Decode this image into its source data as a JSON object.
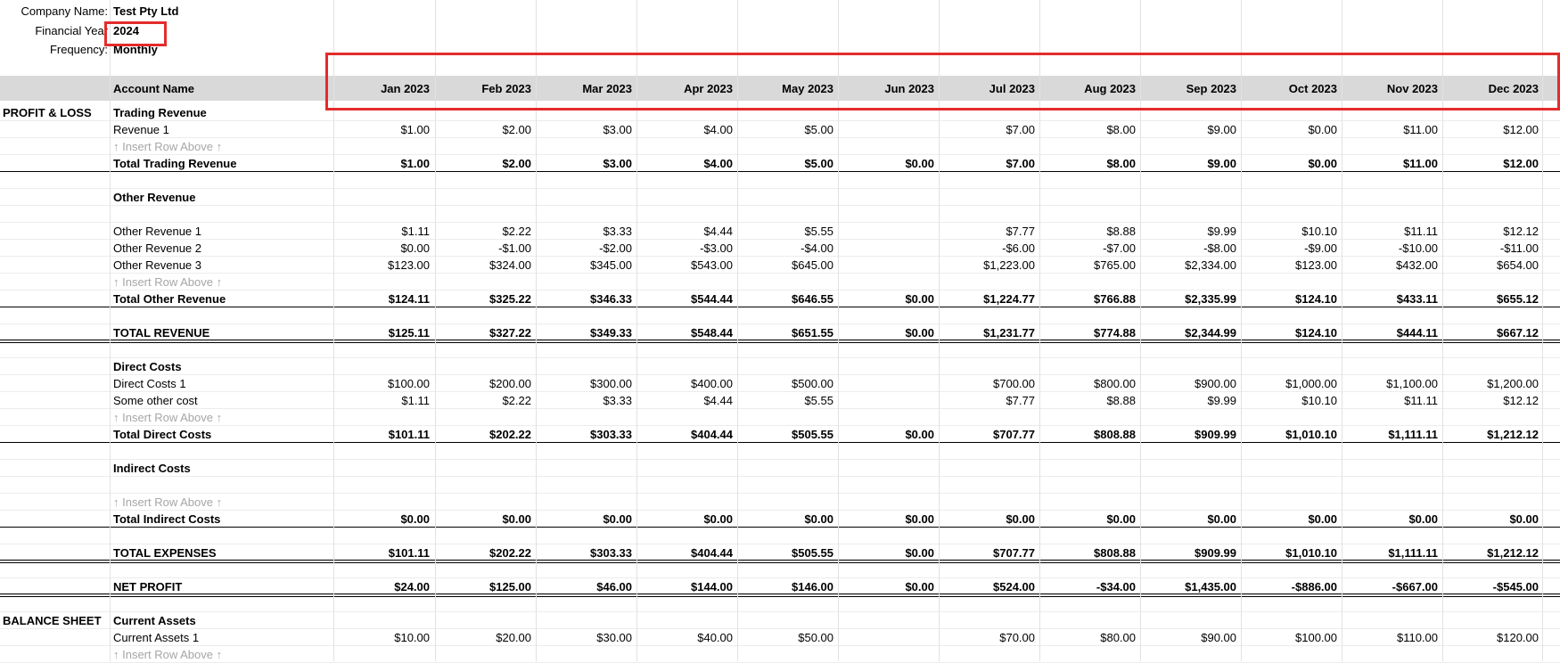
{
  "header": {
    "company_label": "Company Name:",
    "company_value": "Test Pty Ltd",
    "year_label": "Financial Year",
    "year_value": "2024",
    "frequency_label": "Frequency:",
    "frequency_value": "Monthly"
  },
  "table": {
    "account_name_header": "Account Name",
    "months": [
      "Jan 2023",
      "Feb 2023",
      "Mar 2023",
      "Apr 2023",
      "May 2023",
      "Jun 2023",
      "Jul 2023",
      "Aug 2023",
      "Sep 2023",
      "Oct 2023",
      "Nov 2023",
      "Dec 2023"
    ]
  },
  "rows": [
    {
      "type": "section",
      "section": "PROFIT & LOSS",
      "label": "Trading Revenue"
    },
    {
      "type": "data",
      "label": "Revenue 1",
      "values": [
        "$1.00",
        "$2.00",
        "$3.00",
        "$4.00",
        "$5.00",
        "",
        "$7.00",
        "$8.00",
        "$9.00",
        "$0.00",
        "$11.00",
        "$12.00"
      ]
    },
    {
      "type": "insert",
      "label": "↑ Insert Row Above ↑"
    },
    {
      "type": "total",
      "label": "Total Trading Revenue",
      "values": [
        "$1.00",
        "$2.00",
        "$3.00",
        "$4.00",
        "$5.00",
        "$0.00",
        "$7.00",
        "$8.00",
        "$9.00",
        "$0.00",
        "$11.00",
        "$12.00"
      ],
      "rule": "single"
    },
    {
      "type": "blank"
    },
    {
      "type": "heading",
      "label": "Other Revenue"
    },
    {
      "type": "blank"
    },
    {
      "type": "data",
      "label": "Other Revenue 1",
      "values": [
        "$1.11",
        "$2.22",
        "$3.33",
        "$4.44",
        "$5.55",
        "",
        "$7.77",
        "$8.88",
        "$9.99",
        "$10.10",
        "$11.11",
        "$12.12"
      ]
    },
    {
      "type": "data",
      "label": "Other Revenue 2",
      "values": [
        "$0.00",
        "-$1.00",
        "-$2.00",
        "-$3.00",
        "-$4.00",
        "",
        "-$6.00",
        "-$7.00",
        "-$8.00",
        "-$9.00",
        "-$10.00",
        "-$11.00"
      ]
    },
    {
      "type": "data",
      "label": "Other Revenue 3",
      "values": [
        "$123.00",
        "$324.00",
        "$345.00",
        "$543.00",
        "$645.00",
        "",
        "$1,223.00",
        "$765.00",
        "$2,334.00",
        "$123.00",
        "$432.00",
        "$654.00"
      ]
    },
    {
      "type": "insert",
      "label": "↑ Insert Row Above ↑"
    },
    {
      "type": "total",
      "label": "Total Other Revenue",
      "values": [
        "$124.11",
        "$325.22",
        "$346.33",
        "$544.44",
        "$646.55",
        "$0.00",
        "$1,224.77",
        "$766.88",
        "$2,335.99",
        "$124.10",
        "$433.11",
        "$655.12"
      ],
      "rule": "single"
    },
    {
      "type": "blank"
    },
    {
      "type": "total",
      "label": "TOTAL REVENUE",
      "values": [
        "$125.11",
        "$327.22",
        "$349.33",
        "$548.44",
        "$651.55",
        "$0.00",
        "$1,231.77",
        "$774.88",
        "$2,344.99",
        "$124.10",
        "$444.11",
        "$667.12"
      ],
      "rule": "double"
    },
    {
      "type": "blank"
    },
    {
      "type": "heading",
      "label": "Direct Costs"
    },
    {
      "type": "data",
      "label": "Direct Costs 1",
      "values": [
        "$100.00",
        "$200.00",
        "$300.00",
        "$400.00",
        "$500.00",
        "",
        "$700.00",
        "$800.00",
        "$900.00",
        "$1,000.00",
        "$1,100.00",
        "$1,200.00"
      ]
    },
    {
      "type": "data",
      "label": "Some other cost",
      "values": [
        "$1.11",
        "$2.22",
        "$3.33",
        "$4.44",
        "$5.55",
        "",
        "$7.77",
        "$8.88",
        "$9.99",
        "$10.10",
        "$11.11",
        "$12.12"
      ]
    },
    {
      "type": "insert",
      "label": "↑ Insert Row Above ↑"
    },
    {
      "type": "total",
      "label": "Total Direct Costs",
      "values": [
        "$101.11",
        "$202.22",
        "$303.33",
        "$404.44",
        "$505.55",
        "$0.00",
        "$707.77",
        "$808.88",
        "$909.99",
        "$1,010.10",
        "$1,111.11",
        "$1,212.12"
      ],
      "rule": "single"
    },
    {
      "type": "blank"
    },
    {
      "type": "heading",
      "label": "Indirect Costs"
    },
    {
      "type": "blank"
    },
    {
      "type": "insert",
      "label": "↑ Insert Row Above ↑"
    },
    {
      "type": "total",
      "label": "Total Indirect Costs",
      "values": [
        "$0.00",
        "$0.00",
        "$0.00",
        "$0.00",
        "$0.00",
        "$0.00",
        "$0.00",
        "$0.00",
        "$0.00",
        "$0.00",
        "$0.00",
        "$0.00"
      ],
      "rule": "single"
    },
    {
      "type": "blank"
    },
    {
      "type": "total",
      "label": "TOTAL EXPENSES",
      "values": [
        "$101.11",
        "$202.22",
        "$303.33",
        "$404.44",
        "$505.55",
        "$0.00",
        "$707.77",
        "$808.88",
        "$909.99",
        "$1,010.10",
        "$1,111.11",
        "$1,212.12"
      ],
      "rule": "double"
    },
    {
      "type": "blank"
    },
    {
      "type": "total",
      "label": "NET PROFIT",
      "values": [
        "$24.00",
        "$125.00",
        "$46.00",
        "$144.00",
        "$146.00",
        "$0.00",
        "$524.00",
        "-$34.00",
        "$1,435.00",
        "-$886.00",
        "-$667.00",
        "-$545.00"
      ],
      "rule": "double"
    },
    {
      "type": "blank"
    },
    {
      "type": "section",
      "section": "BALANCE SHEET",
      "label": "Current Assets"
    },
    {
      "type": "data",
      "label": "Current Assets 1",
      "values": [
        "$10.00",
        "$20.00",
        "$30.00",
        "$40.00",
        "$50.00",
        "",
        "$70.00",
        "$80.00",
        "$90.00",
        "$100.00",
        "$110.00",
        "$120.00"
      ]
    },
    {
      "type": "insert",
      "label": "↑ Insert Row Above ↑"
    }
  ],
  "colors": {
    "header_band": "#d9d9d9",
    "highlight": "#e32c2c",
    "insert_text": "#a6a6a6",
    "gridline": "#e2e2e2"
  }
}
